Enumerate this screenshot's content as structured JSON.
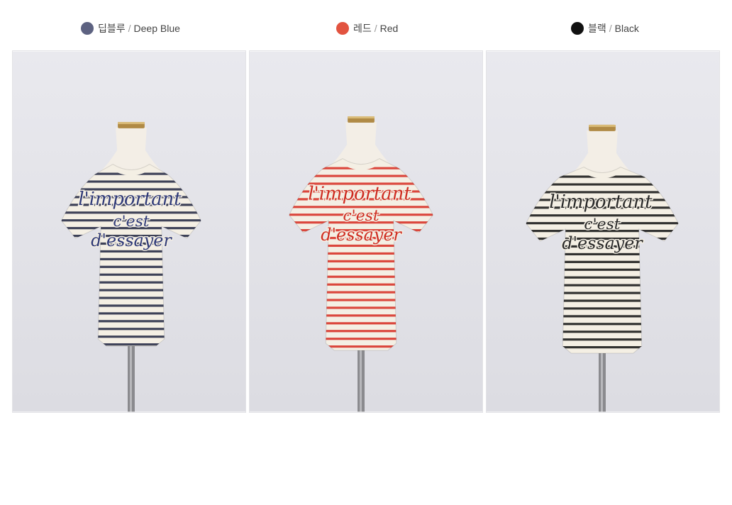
{
  "variants": [
    {
      "korean": "딥블루",
      "separator": "/",
      "english": "Deep Blue",
      "swatch_color": "#5d6281",
      "stripe_color": "#2a2f48",
      "text_color": "#2f3a78",
      "script_lines": [
        "l'important",
        "c'est",
        "d'essayer"
      ]
    },
    {
      "korean": "레드",
      "separator": "/",
      "english": "Red",
      "swatch_color": "#e2533f",
      "stripe_color": "#d8342a",
      "text_color": "#cf2d22",
      "script_lines": [
        "l'important",
        "c'est",
        "d'essayer"
      ]
    },
    {
      "korean": "블랙",
      "separator": "/",
      "english": "Black",
      "swatch_color": "#111111",
      "stripe_color": "#1c1c1c",
      "text_color": "#2a2a2a",
      "script_lines": [
        "l'important",
        "c'est",
        "d'essayer"
      ]
    }
  ],
  "colors": {
    "background": "#ffffff",
    "photo_background": "#e4e4e9",
    "shirt_base": "#f4efe4"
  }
}
